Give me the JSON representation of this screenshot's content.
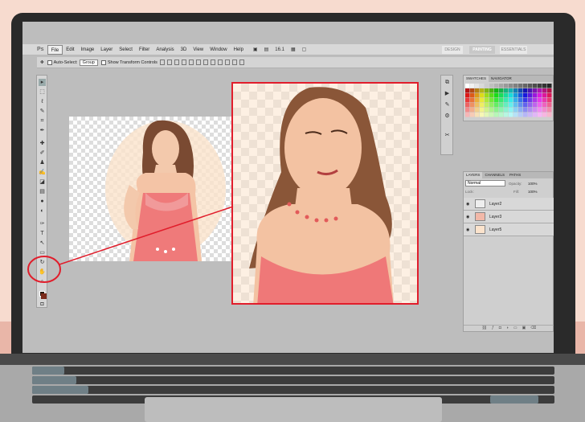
{
  "app": {
    "logo": "Ps"
  },
  "menu": {
    "items": [
      "File",
      "Edit",
      "Image",
      "Layer",
      "Select",
      "Filter",
      "Analysis",
      "3D",
      "View",
      "Window",
      "Help"
    ],
    "zoom": "16.1"
  },
  "workspaces": [
    "DESIGN",
    "PAINTING",
    "ESSENTIALS"
  ],
  "options": {
    "auto_select": "Auto-Select:",
    "auto_select_value": "Group",
    "show_transform": "Show Transform Controls"
  },
  "panels": {
    "swatches_tab": "SWATCHES",
    "navigator_tab": "NAVIGATOR",
    "layers_tab": "LAYERS",
    "channels_tab": "CHANNELS",
    "paths_tab": "PATHS",
    "blend_mode": "Normal",
    "opacity_label": "Opacity:",
    "opacity_value": "100%",
    "fill_label": "Fill:",
    "fill_value": "100%",
    "lock_label": "Lock:",
    "layers": [
      "Layer2",
      "Layer3",
      "Layer5"
    ]
  },
  "colors": {
    "highlight_red": "#e11d2b",
    "fg_swatch": "#2a1a10",
    "bg_swatch": "#7a2a1a"
  }
}
